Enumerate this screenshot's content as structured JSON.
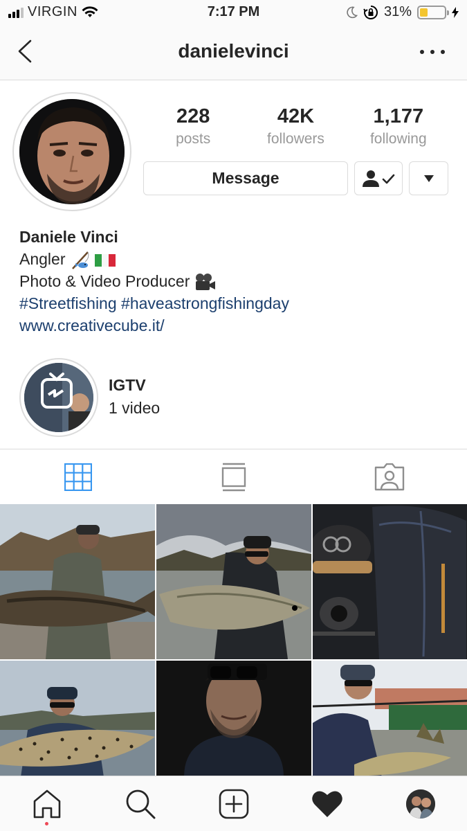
{
  "status_bar": {
    "carrier": "VIRGIN",
    "time": "7:17 PM",
    "battery_percent": "31%",
    "battery_level": 0.31,
    "icons": [
      "signal-icon",
      "wifi-icon",
      "moon-icon",
      "rotation-lock-icon",
      "battery-icon",
      "charging-icon"
    ]
  },
  "header": {
    "username": "danielevinci",
    "back_icon": "chevron-left-icon",
    "more_icon": "more-dots-icon"
  },
  "profile": {
    "posts_count": "228",
    "posts_label": "posts",
    "followers_count": "42K",
    "followers_label": "followers",
    "following_count": "1,177",
    "following_label": "following",
    "message_label": "Message",
    "following_button_icon": "person-check-icon",
    "dropdown_icon": "triangle-down-icon"
  },
  "bio": {
    "name": "Daniele Vinci",
    "line1": "Angler",
    "line1_emojis": [
      "fishing-pole-icon",
      "italy-flag-icon"
    ],
    "line2": "Photo & Video Producer",
    "line2_emoji": "movie-camera-icon",
    "hashtags": "#Streetfishing #haveastrongfishingday",
    "website": "www.creativecube.it/"
  },
  "highlight": {
    "title": "IGTV",
    "subtitle": "1 video",
    "icon": "igtv-icon"
  },
  "tabs": [
    {
      "name": "grid",
      "icon": "grid-icon",
      "active": true
    },
    {
      "name": "feed",
      "icon": "list-view-icon",
      "active": false
    },
    {
      "name": "tagged",
      "icon": "tagged-person-icon",
      "active": false
    }
  ],
  "grid_posts": [
    {
      "subject": "angler holding sturgeon"
    },
    {
      "subject": "angler holding big fish"
    },
    {
      "subject": "fishing gear flat lay"
    },
    {
      "subject": "angler holding trout"
    },
    {
      "subject": "portrait with sunglasses"
    },
    {
      "subject": "angler holding zander"
    }
  ],
  "bottom_nav": [
    {
      "name": "home",
      "icon": "home-icon",
      "active": true
    },
    {
      "name": "search",
      "icon": "search-icon"
    },
    {
      "name": "new-post",
      "icon": "plus-square-icon"
    },
    {
      "name": "activity",
      "icon": "heart-icon"
    },
    {
      "name": "profile",
      "icon": "profile-avatar-icon"
    }
  ],
  "colors": {
    "text": "#262626",
    "secondary_text": "#999999",
    "link": "#1c3f6e",
    "active_tab": "#3897f0",
    "divider": "#dbdbdb",
    "notification_dot": "#ed4956",
    "battery_fill": "#f3c52f"
  }
}
